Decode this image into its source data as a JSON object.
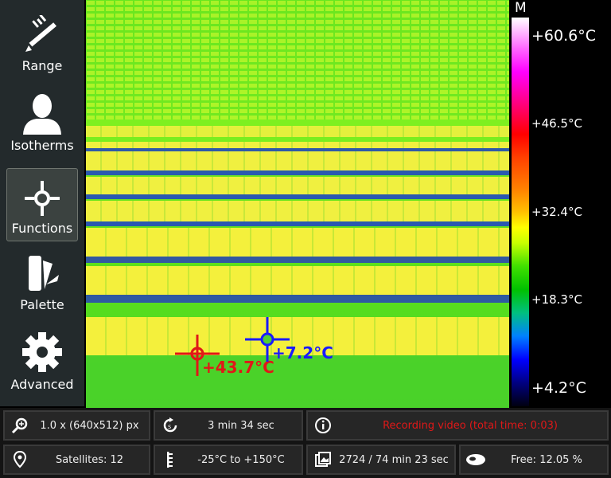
{
  "sidebar": {
    "items": [
      {
        "label": "Range",
        "icon": "range-ruler-icon"
      },
      {
        "label": "Isotherms",
        "icon": "person-silhouette-icon"
      },
      {
        "label": "Functions",
        "icon": "crosshair-icon",
        "selected": true
      },
      {
        "label": "Palette",
        "icon": "palette-swatch-icon"
      },
      {
        "label": "Advanced",
        "icon": "gear-icon"
      }
    ]
  },
  "thermal_view": {
    "spot_hot": {
      "value": "+43.7°C",
      "color": "#e01818"
    },
    "spot_cold": {
      "value": "+7.2°C",
      "color": "#1a1aff"
    }
  },
  "scale": {
    "mode": "M",
    "max": "+60.6°C",
    "ticks": [
      "+46.5°C",
      "+32.4°C",
      "+18.3°C"
    ],
    "min": "+4.2°C"
  },
  "status": {
    "zoom": "1.0 x (640x512) px",
    "time_remaining": "3 min 34 sec",
    "recording": "Recording video (total time: 0:03)",
    "recording_color": "#e01818",
    "satellites": "Satellites: 12",
    "temp_range": "-25°C to +150°C",
    "images": "2724 / 74 min 23 sec",
    "free": "Free: 12.05 %"
  }
}
